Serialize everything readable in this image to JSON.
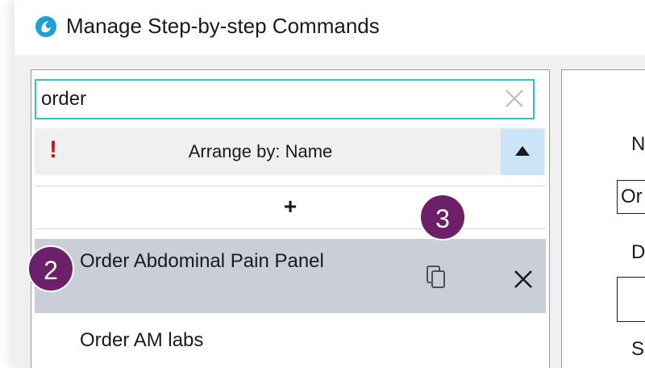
{
  "window": {
    "title": "Manage Step-by-step Commands",
    "app_icon": "dragon-app-icon"
  },
  "search": {
    "value": "order",
    "clear_icon": "close-icon"
  },
  "arrange": {
    "alert_symbol": "!",
    "label": "Arrange by: Name",
    "sort_icon": "triangle-up-icon"
  },
  "add_row": {
    "label": "+"
  },
  "commands": [
    {
      "label": "Order Abdominal Pain Panel",
      "selected": true
    },
    {
      "label": "Order AM labs",
      "selected": false
    }
  ],
  "right_panel": {
    "name_label": "N",
    "name_value": "Or",
    "description_label": "D",
    "spec_label": "Sp"
  },
  "callouts": {
    "badge_2": "2",
    "badge_3": "3"
  },
  "colors": {
    "search_border": "#2ec4c4",
    "selected_row": "#c9ced8",
    "sort_button": "#cce4f7",
    "alert": "#d4141c",
    "callout": "#6b2069"
  }
}
